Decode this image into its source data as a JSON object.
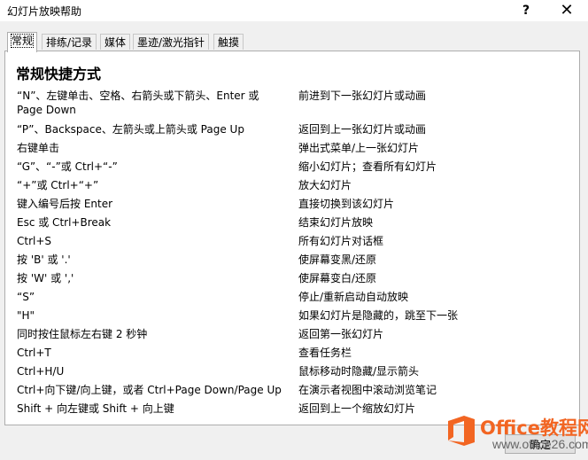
{
  "window": {
    "title": "幻灯片放映帮助",
    "help_glyph": "?",
    "close_glyph": "✕"
  },
  "tabs": [
    {
      "label": "常规",
      "active": true
    },
    {
      "label": "排练/记录",
      "active": false
    },
    {
      "label": "媒体",
      "active": false
    },
    {
      "label": "墨迹/激光指针",
      "active": false
    },
    {
      "label": "触摸",
      "active": false
    }
  ],
  "panel": {
    "heading": "常规快捷方式",
    "shortcuts": [
      {
        "key": "“N”、左键单击、空格、右箭头或下箭头、Enter 或 Page Down",
        "action": "前进到下一张幻灯片或动画"
      },
      {
        "key": "“P”、Backspace、左箭头或上箭头或 Page Up",
        "action": "返回到上一张幻灯片或动画"
      },
      {
        "key": "右键单击",
        "action": "弹出式菜单/上一张幻灯片"
      },
      {
        "key": "“G”、“-”或 Ctrl+“-”",
        "action": "缩小幻灯片；查看所有幻灯片"
      },
      {
        "key": "“+”或 Ctrl+“+”",
        "action": "放大幻灯片"
      },
      {
        "key": "键入编号后按 Enter",
        "action": "直接切换到该幻灯片"
      },
      {
        "key": "Esc 或 Ctrl+Break",
        "action": "结束幻灯片放映"
      },
      {
        "key": "Ctrl+S",
        "action": "所有幻灯片对话框"
      },
      {
        "key": "按 'B' 或 '.'",
        "action": "使屏幕变黑/还原"
      },
      {
        "key": "按 'W' 或 ','",
        "action": "使屏幕变白/还原"
      },
      {
        "key": "“S”",
        "action": "停止/重新启动自动放映"
      },
      {
        "key": "\"H\"",
        "action": "如果幻灯片是隐藏的，跳至下一张"
      },
      {
        "key": "同时按住鼠标左右键 2 秒钟",
        "action": "返回第一张幻灯片"
      },
      {
        "key": "Ctrl+T",
        "action": "查看任务栏"
      },
      {
        "key": "Ctrl+H/U",
        "action": "鼠标移动时隐藏/显示箭头"
      },
      {
        "key": "Ctrl+向下键/向上键，或者 Ctrl+Page Down/Page Up",
        "action": "在演示者视图中滚动浏览笔记"
      },
      {
        "key": "Shift + 向左键或 Shift + 向上键",
        "action": "返回到上一个缩放幻灯片"
      }
    ]
  },
  "footer": {
    "ok_label": "确定"
  },
  "watermark": {
    "brand": "Office教程网",
    "site": "www.office26.com",
    "color": "#f26522"
  }
}
